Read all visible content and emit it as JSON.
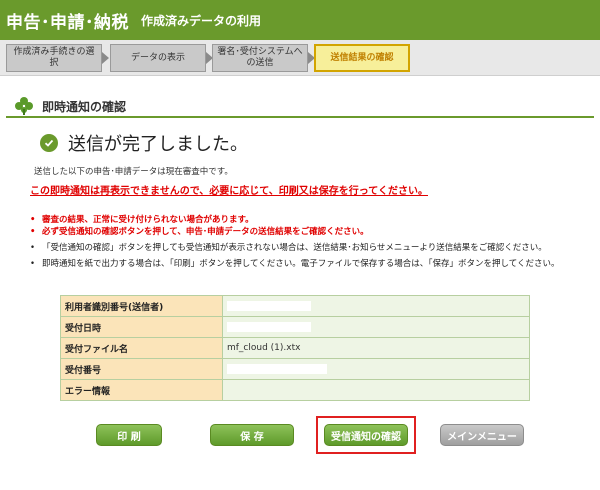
{
  "header": {
    "brand": "申告･申請･納税",
    "subtitle": "作成済みデータの利用"
  },
  "steps": [
    {
      "label": "作成済み手続きの選択"
    },
    {
      "label": "データの表示"
    },
    {
      "label": "署名･受付システムへの送信"
    },
    {
      "label": "送信結果の確認",
      "active": true
    }
  ],
  "section": {
    "title": "即時通知の確認",
    "icon": "clover-icon"
  },
  "complete": {
    "message": "送信が完了しました。"
  },
  "notice": {
    "line1": "送信した以下の申告･申請データは現在審査中です。",
    "warning": "この即時通知は再表示できませんので、必要に応じて、印刷又は保存を行ってください。"
  },
  "bullets": [
    {
      "text": "審査の結果、正常に受け付けられない場合があります。",
      "red": true
    },
    {
      "text": "必ず受信通知の確認ボタンを押して、申告･申請データの送信結果をご確認ください。",
      "red": true,
      "noBullet": true
    },
    {
      "text": "「受信通知の確認」ボタンを押しても受信通知が表示されない場合は、送信結果･お知らせメニューより送信結果をご確認ください。"
    },
    {
      "text": "即時通知を紙で出力する場合は、「印刷」ボタンを押してください。電子ファイルで保存する場合は、「保存」ボタンを押してください。"
    }
  ],
  "table": {
    "rows": [
      {
        "label": "利用者識別番号(送信者)",
        "value": ""
      },
      {
        "label": "受付日時",
        "value": ""
      },
      {
        "label": "受付ファイル名",
        "value": "mf_cloud (1).xtx"
      },
      {
        "label": "受付番号",
        "value": ""
      },
      {
        "label": "エラー情報",
        "value": ""
      }
    ]
  },
  "buttons": {
    "print": "印 刷",
    "save": "保 存",
    "check": "受信通知の確認",
    "main_menu": "メインメニュー"
  },
  "colors": {
    "header_green": "#6a9a2c",
    "active_step": "#f7ef9a",
    "warning_red": "#e00000",
    "focus_outline": "#e02020"
  }
}
